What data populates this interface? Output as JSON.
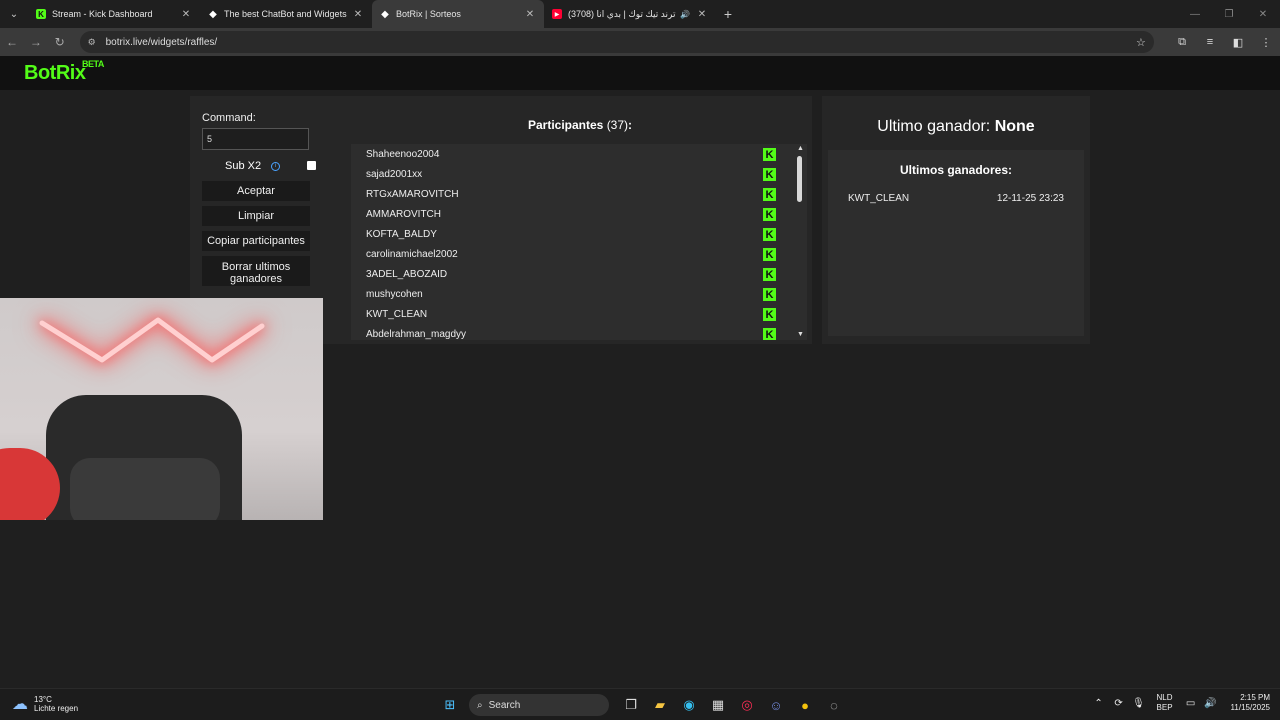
{
  "browser": {
    "tabs": [
      {
        "title": "Stream - Kick Dashboard",
        "icon": "kick-icon",
        "active": false
      },
      {
        "title": "The best ChatBot and Widgets",
        "icon": "botrix-icon",
        "active": false
      },
      {
        "title": "BotRix | Sorteos",
        "icon": "botrix-icon",
        "active": true
      },
      {
        "title": "(3708) ترند تيك توك | بدي انا",
        "icon": "youtube-icon",
        "active": false
      }
    ],
    "url": "botrix.live/widgets/raffles/"
  },
  "site": {
    "logo": "BotRix",
    "logo_badge": "BETA"
  },
  "controls": {
    "command_label": "Command:",
    "command_value": "5",
    "sub_label": "Sub X2",
    "sub_checked": false,
    "accept": "Aceptar",
    "clear": "Limpiar",
    "copy": "Copiar participantes",
    "delete_winners": "Borrar ultimos ganadores"
  },
  "participants": {
    "title": "Participantes",
    "count": "(37)",
    "colon": ":",
    "list": [
      "Shaheenoo2004",
      "sajad2001xx",
      "RTGxAMAROVITCH",
      "AMMAROVITCH",
      "KOFTA_BALDY",
      "carolinamichael2002",
      "3ADEL_ABOZAID",
      "mushycohen",
      "KWT_CLEAN",
      "Abdelrahman_magdyy"
    ]
  },
  "winners": {
    "last_label": "Ultimo ganador:",
    "last_value": "None",
    "list_title": "Ultimos ganadores:",
    "list": [
      {
        "name": "KWT_CLEAN",
        "date": "12-11-25 23:23"
      }
    ]
  },
  "taskbar": {
    "temp": "13°C",
    "weather": "Lichte regen",
    "search": "Search",
    "lang_top": "NLD",
    "lang_bottom": "BEP",
    "time": "2:15 PM",
    "date": "11/15/2025"
  }
}
